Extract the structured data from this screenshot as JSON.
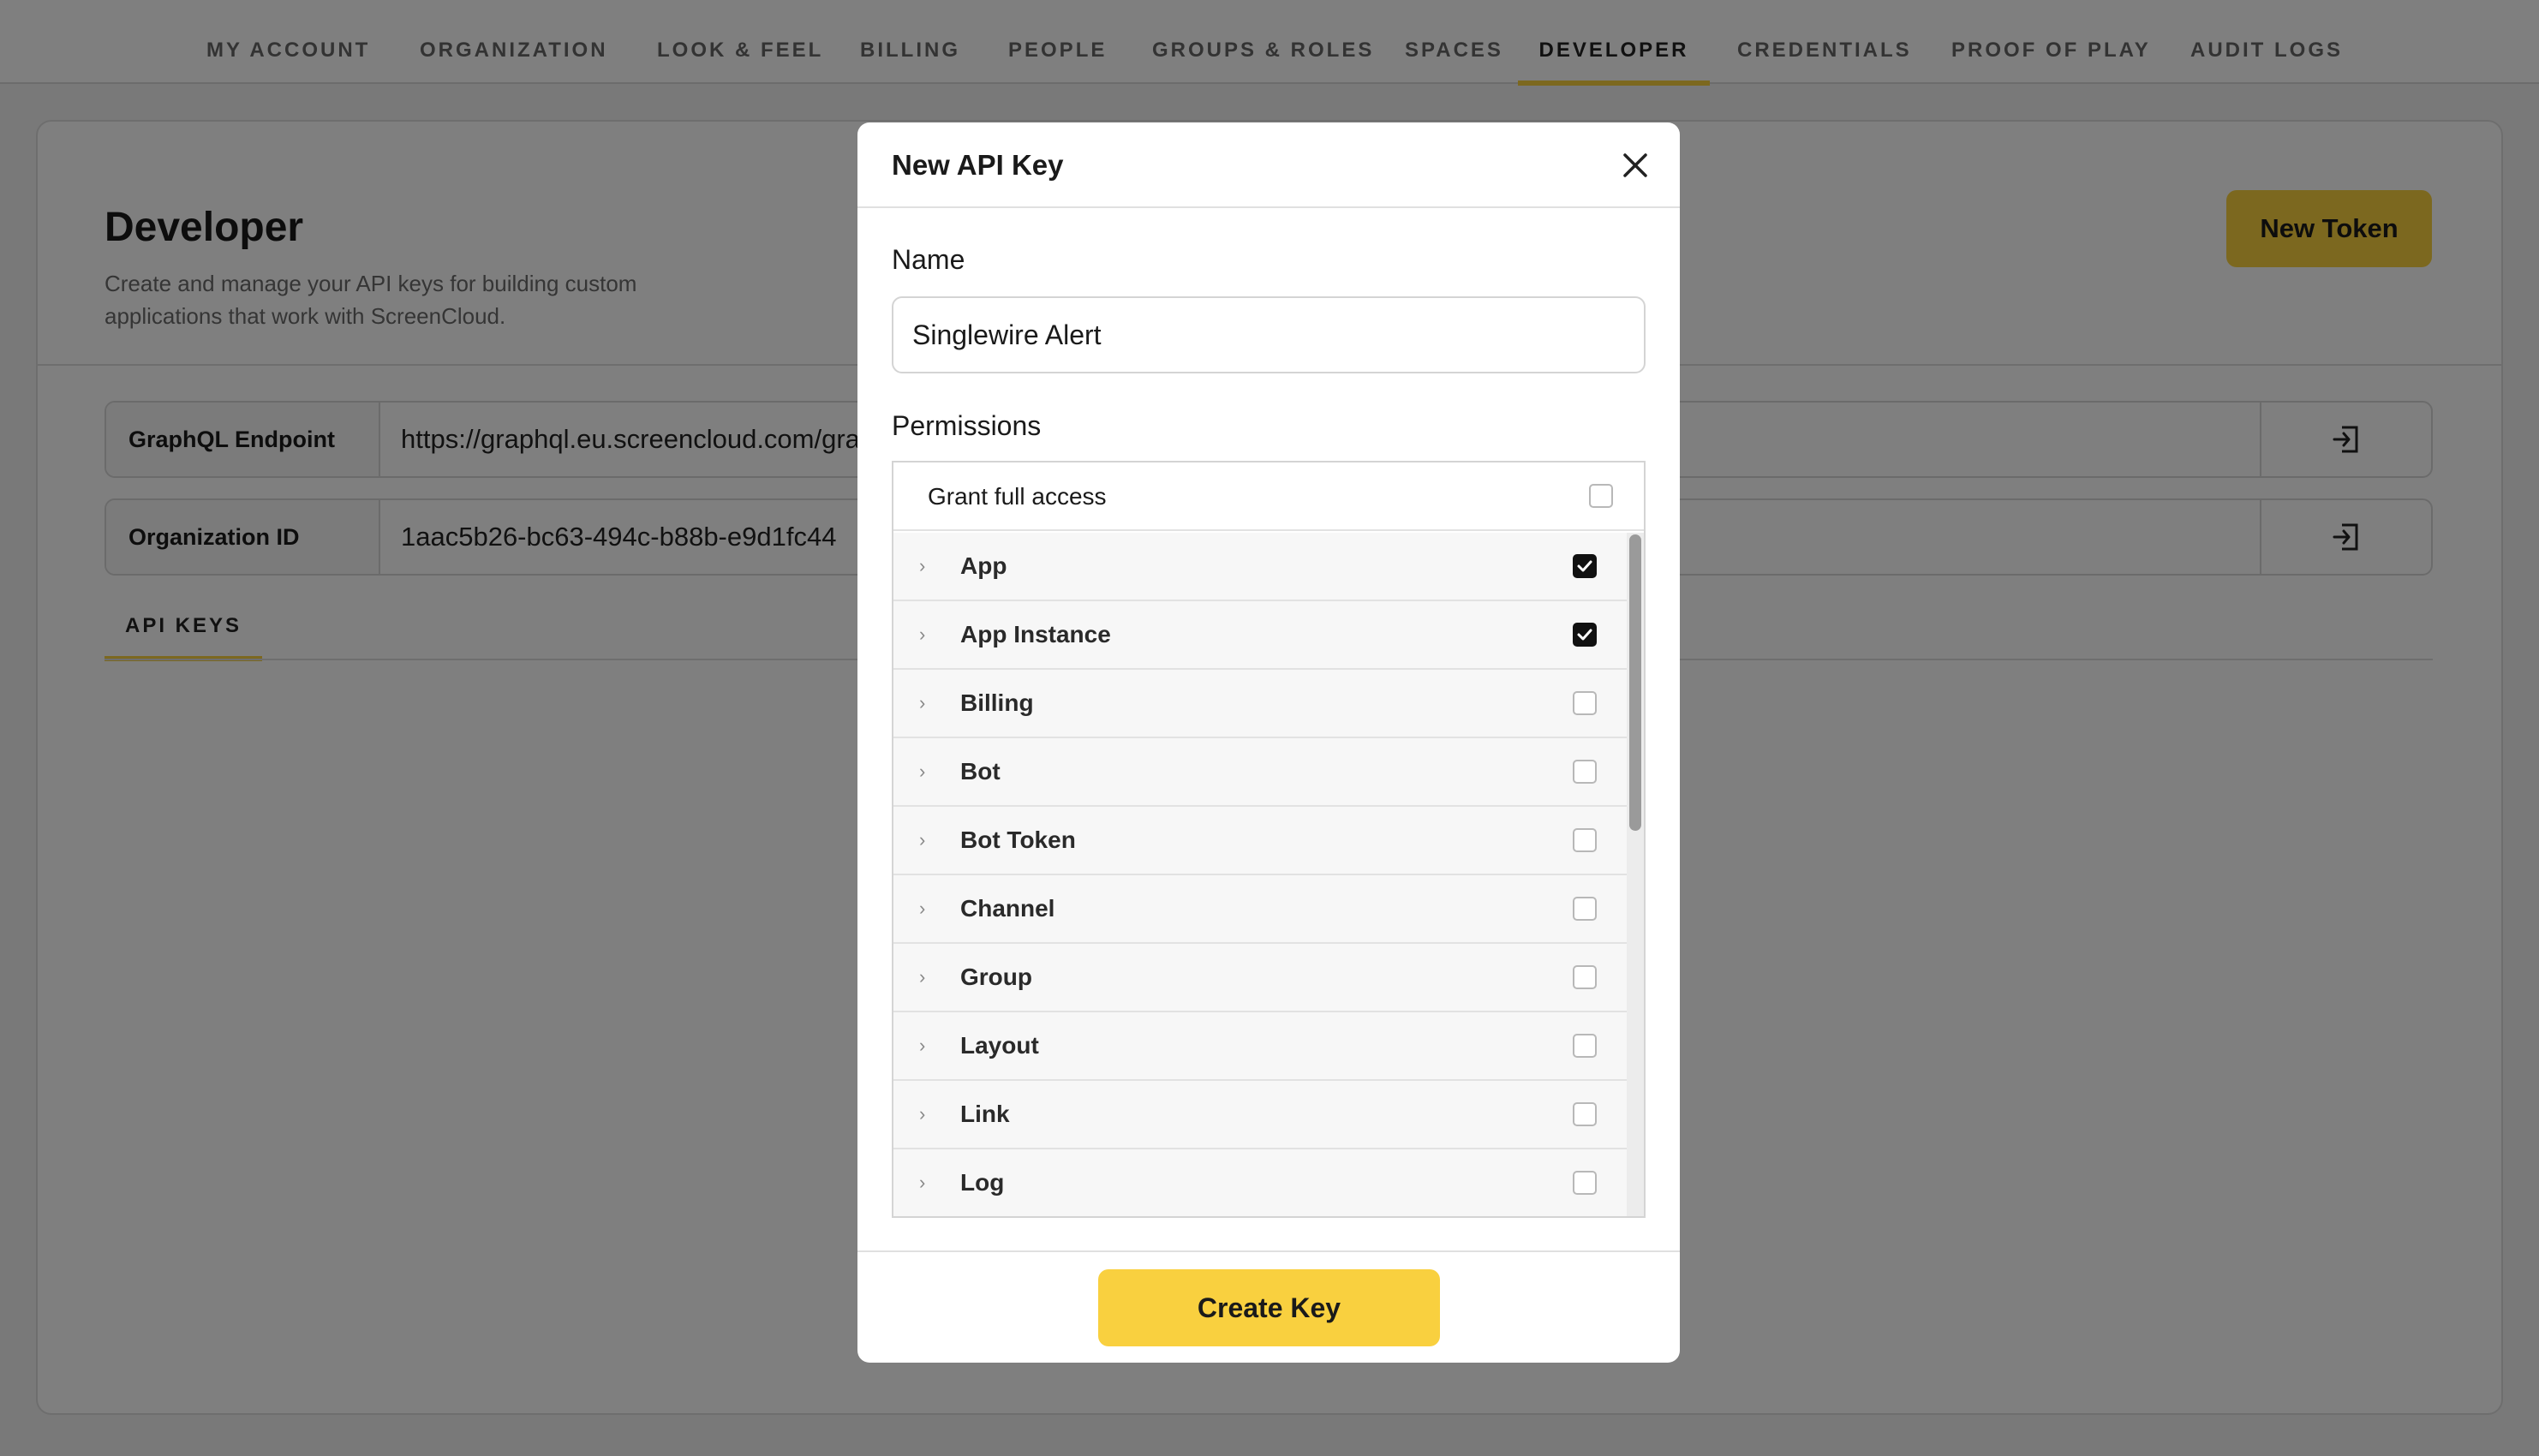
{
  "nav": {
    "items": [
      {
        "label": "MY ACCOUNT"
      },
      {
        "label": "ORGANIZATION"
      },
      {
        "label": "LOOK & FEEL"
      },
      {
        "label": "BILLING"
      },
      {
        "label": "PEOPLE"
      },
      {
        "label": "GROUPS & ROLES"
      },
      {
        "label": "SPACES"
      },
      {
        "label": "DEVELOPER"
      },
      {
        "label": "CREDENTIALS"
      },
      {
        "label": "PROOF OF PLAY"
      },
      {
        "label": "AUDIT LOGS"
      }
    ],
    "active": "DEVELOPER"
  },
  "page": {
    "title": "Developer",
    "description": "Create and manage your API keys for building custom applications that work with ScreenCloud.",
    "new_token_label": "New Token"
  },
  "fields": {
    "graphql": {
      "label": "GraphQL Endpoint",
      "value": "https://graphql.eu.screencloud.com/gra"
    },
    "org_id": {
      "label": "Organization ID",
      "value": "1aac5b26-bc63-494c-b88b-e9d1fc44"
    }
  },
  "tabs": {
    "api_keys": "API KEYS"
  },
  "modal": {
    "title": "New API Key",
    "name_label": "Name",
    "name_value": "Singlewire Alert",
    "permissions_label": "Permissions",
    "grant_full_access": {
      "label": "Grant full access",
      "checked": false
    },
    "permissions": [
      {
        "label": "App",
        "checked": true
      },
      {
        "label": "App Instance",
        "checked": true
      },
      {
        "label": "Billing",
        "checked": false
      },
      {
        "label": "Bot",
        "checked": false
      },
      {
        "label": "Bot Token",
        "checked": false
      },
      {
        "label": "Channel",
        "checked": false
      },
      {
        "label": "Group",
        "checked": false
      },
      {
        "label": "Layout",
        "checked": false
      },
      {
        "label": "Link",
        "checked": false
      },
      {
        "label": "Log",
        "checked": false
      }
    ],
    "create_label": "Create Key"
  },
  "colors": {
    "accent": "#f9d03f",
    "overlay": "rgba(0,0,0,0.5)"
  }
}
